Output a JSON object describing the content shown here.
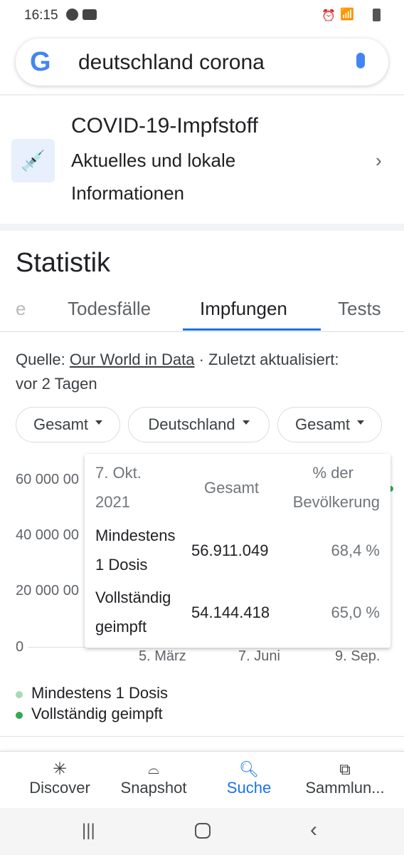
{
  "status": {
    "time": "16:15"
  },
  "search": {
    "query": "deutschland corona"
  },
  "vaccine_card": {
    "title": "COVID-19-Impfstoff",
    "line1": "Aktuelles und lokale",
    "line2": "Informationen"
  },
  "stats": {
    "title": "Statistik",
    "tabs": [
      {
        "label": "e"
      },
      {
        "label": "Todesfälle"
      },
      {
        "label": "Impfungen",
        "active": true
      },
      {
        "label": "Tests"
      }
    ],
    "source_prefix": "Quelle: ",
    "source_link": "Our World in Data",
    "source_suffix": " · Zuletzt aktualisiert:",
    "updated": "vor 2 Tagen",
    "filters": [
      "Gesamt",
      "Deutschland",
      "Gesamt"
    ]
  },
  "chart_data": {
    "type": "line",
    "y_ticks": [
      "60 000 00",
      "40 000 00",
      "20 000 00",
      "0"
    ],
    "x_ticks": [
      "5. März",
      "7. Juni",
      "9. Sep."
    ],
    "series": [
      {
        "name": "Mindestens 1 Dosis",
        "color": "#a8dab5"
      },
      {
        "name": "Vollständig geimpft",
        "color": "#34a853"
      }
    ]
  },
  "tooltip": {
    "date1": "7. Okt.",
    "date2": "2021",
    "col_total": "Gesamt",
    "col_pct1": "% der",
    "col_pct2": "Bevölkerung",
    "rows": [
      {
        "l1": "Mindestens",
        "l2": "1 Dosis",
        "total": "56.911.049",
        "pct": "68,4 %"
      },
      {
        "l1": "Vollständig",
        "l2": "geimpft",
        "total": "54.144.418",
        "pct": "65,0 %"
      }
    ]
  },
  "nav": [
    {
      "label": "Discover"
    },
    {
      "label": "Snapshot"
    },
    {
      "label": "Suche",
      "active": true
    },
    {
      "label": "Sammlun..."
    }
  ],
  "colors": {
    "accent": "#1a73e8",
    "green": "#34a853"
  }
}
